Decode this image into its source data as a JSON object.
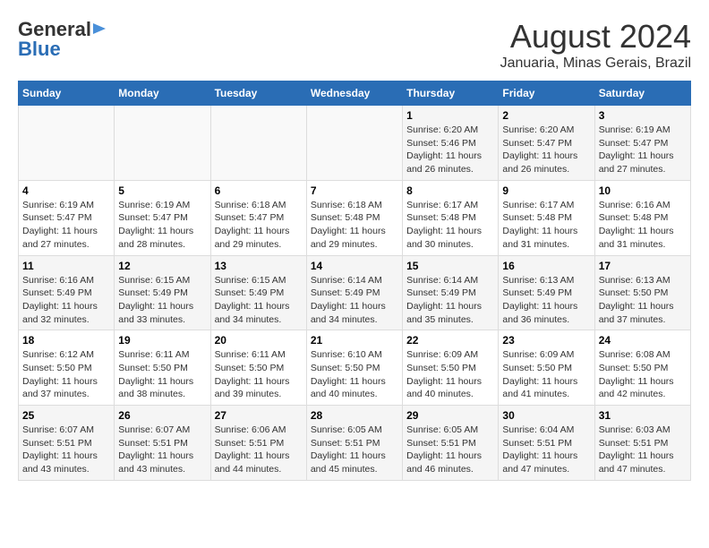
{
  "header": {
    "logo_line1": "General",
    "logo_line2": "Blue",
    "title": "August 2024",
    "subtitle": "Januaria, Minas Gerais, Brazil"
  },
  "weekdays": [
    "Sunday",
    "Monday",
    "Tuesday",
    "Wednesday",
    "Thursday",
    "Friday",
    "Saturday"
  ],
  "weeks": [
    [
      {
        "day": "",
        "info": ""
      },
      {
        "day": "",
        "info": ""
      },
      {
        "day": "",
        "info": ""
      },
      {
        "day": "",
        "info": ""
      },
      {
        "day": "1",
        "info": "Sunrise: 6:20 AM\nSunset: 5:46 PM\nDaylight: 11 hours\nand 26 minutes."
      },
      {
        "day": "2",
        "info": "Sunrise: 6:20 AM\nSunset: 5:47 PM\nDaylight: 11 hours\nand 26 minutes."
      },
      {
        "day": "3",
        "info": "Sunrise: 6:19 AM\nSunset: 5:47 PM\nDaylight: 11 hours\nand 27 minutes."
      }
    ],
    [
      {
        "day": "4",
        "info": "Sunrise: 6:19 AM\nSunset: 5:47 PM\nDaylight: 11 hours\nand 27 minutes."
      },
      {
        "day": "5",
        "info": "Sunrise: 6:19 AM\nSunset: 5:47 PM\nDaylight: 11 hours\nand 28 minutes."
      },
      {
        "day": "6",
        "info": "Sunrise: 6:18 AM\nSunset: 5:47 PM\nDaylight: 11 hours\nand 29 minutes."
      },
      {
        "day": "7",
        "info": "Sunrise: 6:18 AM\nSunset: 5:48 PM\nDaylight: 11 hours\nand 29 minutes."
      },
      {
        "day": "8",
        "info": "Sunrise: 6:17 AM\nSunset: 5:48 PM\nDaylight: 11 hours\nand 30 minutes."
      },
      {
        "day": "9",
        "info": "Sunrise: 6:17 AM\nSunset: 5:48 PM\nDaylight: 11 hours\nand 31 minutes."
      },
      {
        "day": "10",
        "info": "Sunrise: 6:16 AM\nSunset: 5:48 PM\nDaylight: 11 hours\nand 31 minutes."
      }
    ],
    [
      {
        "day": "11",
        "info": "Sunrise: 6:16 AM\nSunset: 5:49 PM\nDaylight: 11 hours\nand 32 minutes."
      },
      {
        "day": "12",
        "info": "Sunrise: 6:15 AM\nSunset: 5:49 PM\nDaylight: 11 hours\nand 33 minutes."
      },
      {
        "day": "13",
        "info": "Sunrise: 6:15 AM\nSunset: 5:49 PM\nDaylight: 11 hours\nand 34 minutes."
      },
      {
        "day": "14",
        "info": "Sunrise: 6:14 AM\nSunset: 5:49 PM\nDaylight: 11 hours\nand 34 minutes."
      },
      {
        "day": "15",
        "info": "Sunrise: 6:14 AM\nSunset: 5:49 PM\nDaylight: 11 hours\nand 35 minutes."
      },
      {
        "day": "16",
        "info": "Sunrise: 6:13 AM\nSunset: 5:49 PM\nDaylight: 11 hours\nand 36 minutes."
      },
      {
        "day": "17",
        "info": "Sunrise: 6:13 AM\nSunset: 5:50 PM\nDaylight: 11 hours\nand 37 minutes."
      }
    ],
    [
      {
        "day": "18",
        "info": "Sunrise: 6:12 AM\nSunset: 5:50 PM\nDaylight: 11 hours\nand 37 minutes."
      },
      {
        "day": "19",
        "info": "Sunrise: 6:11 AM\nSunset: 5:50 PM\nDaylight: 11 hours\nand 38 minutes."
      },
      {
        "day": "20",
        "info": "Sunrise: 6:11 AM\nSunset: 5:50 PM\nDaylight: 11 hours\nand 39 minutes."
      },
      {
        "day": "21",
        "info": "Sunrise: 6:10 AM\nSunset: 5:50 PM\nDaylight: 11 hours\nand 40 minutes."
      },
      {
        "day": "22",
        "info": "Sunrise: 6:09 AM\nSunset: 5:50 PM\nDaylight: 11 hours\nand 40 minutes."
      },
      {
        "day": "23",
        "info": "Sunrise: 6:09 AM\nSunset: 5:50 PM\nDaylight: 11 hours\nand 41 minutes."
      },
      {
        "day": "24",
        "info": "Sunrise: 6:08 AM\nSunset: 5:50 PM\nDaylight: 11 hours\nand 42 minutes."
      }
    ],
    [
      {
        "day": "25",
        "info": "Sunrise: 6:07 AM\nSunset: 5:51 PM\nDaylight: 11 hours\nand 43 minutes."
      },
      {
        "day": "26",
        "info": "Sunrise: 6:07 AM\nSunset: 5:51 PM\nDaylight: 11 hours\nand 43 minutes."
      },
      {
        "day": "27",
        "info": "Sunrise: 6:06 AM\nSunset: 5:51 PM\nDaylight: 11 hours\nand 44 minutes."
      },
      {
        "day": "28",
        "info": "Sunrise: 6:05 AM\nSunset: 5:51 PM\nDaylight: 11 hours\nand 45 minutes."
      },
      {
        "day": "29",
        "info": "Sunrise: 6:05 AM\nSunset: 5:51 PM\nDaylight: 11 hours\nand 46 minutes."
      },
      {
        "day": "30",
        "info": "Sunrise: 6:04 AM\nSunset: 5:51 PM\nDaylight: 11 hours\nand 47 minutes."
      },
      {
        "day": "31",
        "info": "Sunrise: 6:03 AM\nSunset: 5:51 PM\nDaylight: 11 hours\nand 47 minutes."
      }
    ]
  ]
}
